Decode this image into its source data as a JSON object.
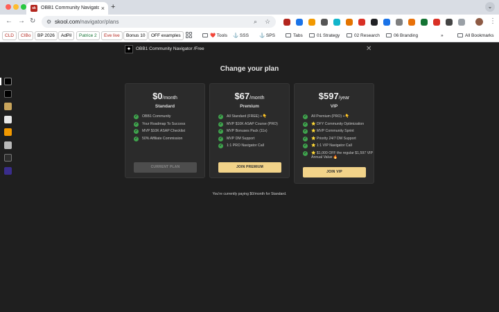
{
  "browser": {
    "tab_title": "OBB1 Community Navigator /",
    "tab_favicon_text": "sk",
    "url_host": "skool.com",
    "url_path": "/navigator/plans"
  },
  "bookmarks": {
    "chips": [
      {
        "label": "CLD",
        "color": "#b3261e"
      },
      {
        "label": "CIBo",
        "color": "#b3261e"
      },
      {
        "label": "BP 2026",
        "color": "#333333"
      },
      {
        "label": "AdPil",
        "color": "#333333"
      },
      {
        "label": "Patrice 2",
        "color": "#137333"
      },
      {
        "label": "Eve live",
        "color": "#b3261e"
      },
      {
        "label": "Bonus 10",
        "color": "#333333"
      },
      {
        "label": "OFF examples",
        "color": "#333333"
      }
    ],
    "items": [
      "❤️ Tools",
      "⚓ SSS",
      "⚓ SPS",
      "Tabs",
      "01 Strategy",
      "02 Research",
      "06 Branding"
    ],
    "overflow": "»",
    "all_bookmarks": "All Bookmarks"
  },
  "header": {
    "title": "OBB1 Community Navigator /Free",
    "close_glyph": "✕"
  },
  "page": {
    "heading": "Change your plan",
    "footer_note": "You're currently paying $0/month for Standard."
  },
  "plans": [
    {
      "price": "$0",
      "period": "/month",
      "name": "Standard",
      "features": [
        "OBB1 Community",
        "Your Roadmap To Success",
        "MVP $10K ASAP Checklist",
        "50% Affiliate Commission"
      ],
      "button": "CURRENT PLAN",
      "button_state": "disabled"
    },
    {
      "price": "$67",
      "period": "/month",
      "name": "Premium",
      "features": [
        "All Standard (FREE) +👇",
        "MVP $10K ASAP Course (PRO)",
        "MVP Bonuses Pack (11x)",
        "MVP DM Support",
        "1:1 PRO Navigator Call"
      ],
      "button": "JOIN PREMIUM",
      "button_state": "active"
    },
    {
      "price": "$597",
      "period": "/year",
      "name": "VIP",
      "features": [
        "All Premium (PRO) +👇",
        "⭐ DFY Community Optimization",
        "⭐ MVP Community Sprint",
        "⭐ Priority 24/7 DM Support",
        "⭐ 1:1 VIP Navigator Call",
        "⭐ $1,000 OFF the regular $1,597 VIP Annual Value 🔥"
      ],
      "button": "JOIN VIP",
      "button_state": "active"
    }
  ],
  "colors": {
    "accent_gold": "#f2d389",
    "check_green": "#3fa34d",
    "card_bg": "#2b2b2b",
    "page_bg": "#1f1f1f"
  }
}
